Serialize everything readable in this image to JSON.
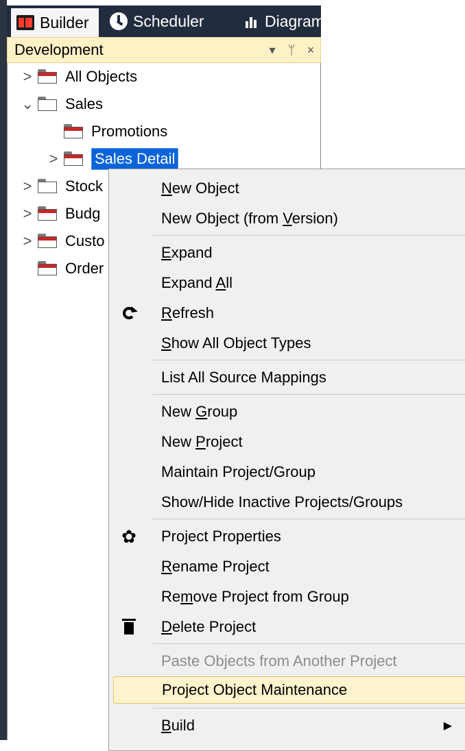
{
  "tabs": [
    {
      "label": "Builder",
      "icon": "builder-icon"
    },
    {
      "label": "Scheduler",
      "icon": "clock-icon"
    },
    {
      "label": "Diagram",
      "icon": "bar-chart-icon"
    }
  ],
  "panel": {
    "title": "Development",
    "dropdown_glyph": "▾",
    "pin_glyph": "ᛘ",
    "close_glyph": "×"
  },
  "tree": [
    {
      "label": "All Objects",
      "expander": ">"
    },
    {
      "label": "Sales",
      "expander": "⌄"
    },
    {
      "label": "Promotions",
      "expander": ""
    },
    {
      "label": "Sales Detail",
      "expander": ">"
    },
    {
      "label": "Stock",
      "expander": ">"
    },
    {
      "label": "Budg",
      "expander": ">"
    },
    {
      "label": "Custo",
      "expander": ">"
    },
    {
      "label": "Order",
      "expander": ""
    }
  ],
  "menu": {
    "items": [
      {
        "pre": "",
        "u": "N",
        "post": "ew Object"
      },
      {
        "pre": "New Object (from ",
        "u": "V",
        "post": "ersion)"
      },
      {
        "pre": "",
        "u": "E",
        "post": "xpand"
      },
      {
        "pre": "Expand ",
        "u": "A",
        "post": "ll"
      },
      {
        "pre": "",
        "u": "R",
        "post": "efresh"
      },
      {
        "pre": "",
        "u": "S",
        "post": "how All Object Types"
      },
      {
        "pre": "List All Source Mappings",
        "u": "",
        "post": ""
      },
      {
        "pre": "New ",
        "u": "G",
        "post": "roup"
      },
      {
        "pre": "New ",
        "u": "P",
        "post": "roject"
      },
      {
        "pre": "Maintain Project/Group",
        "u": "",
        "post": ""
      },
      {
        "pre": "Show/Hide Inactive Projects/Groups",
        "u": "",
        "post": ""
      },
      {
        "pre": "Project Properties",
        "u": "",
        "post": ""
      },
      {
        "pre": "",
        "u": "R",
        "post": "ename Project"
      },
      {
        "pre": "Re",
        "u": "m",
        "post": "ove Project from Group"
      },
      {
        "pre": "",
        "u": "D",
        "post": "elete Project"
      },
      {
        "pre": "Paste Objects from Another Project",
        "u": "",
        "post": ""
      },
      {
        "pre": "Project Object Maintenance",
        "u": "",
        "post": ""
      },
      {
        "pre": "",
        "u": "B",
        "post": "uild"
      }
    ],
    "submenu_arrow": "▶",
    "gear_glyph": "✿"
  }
}
